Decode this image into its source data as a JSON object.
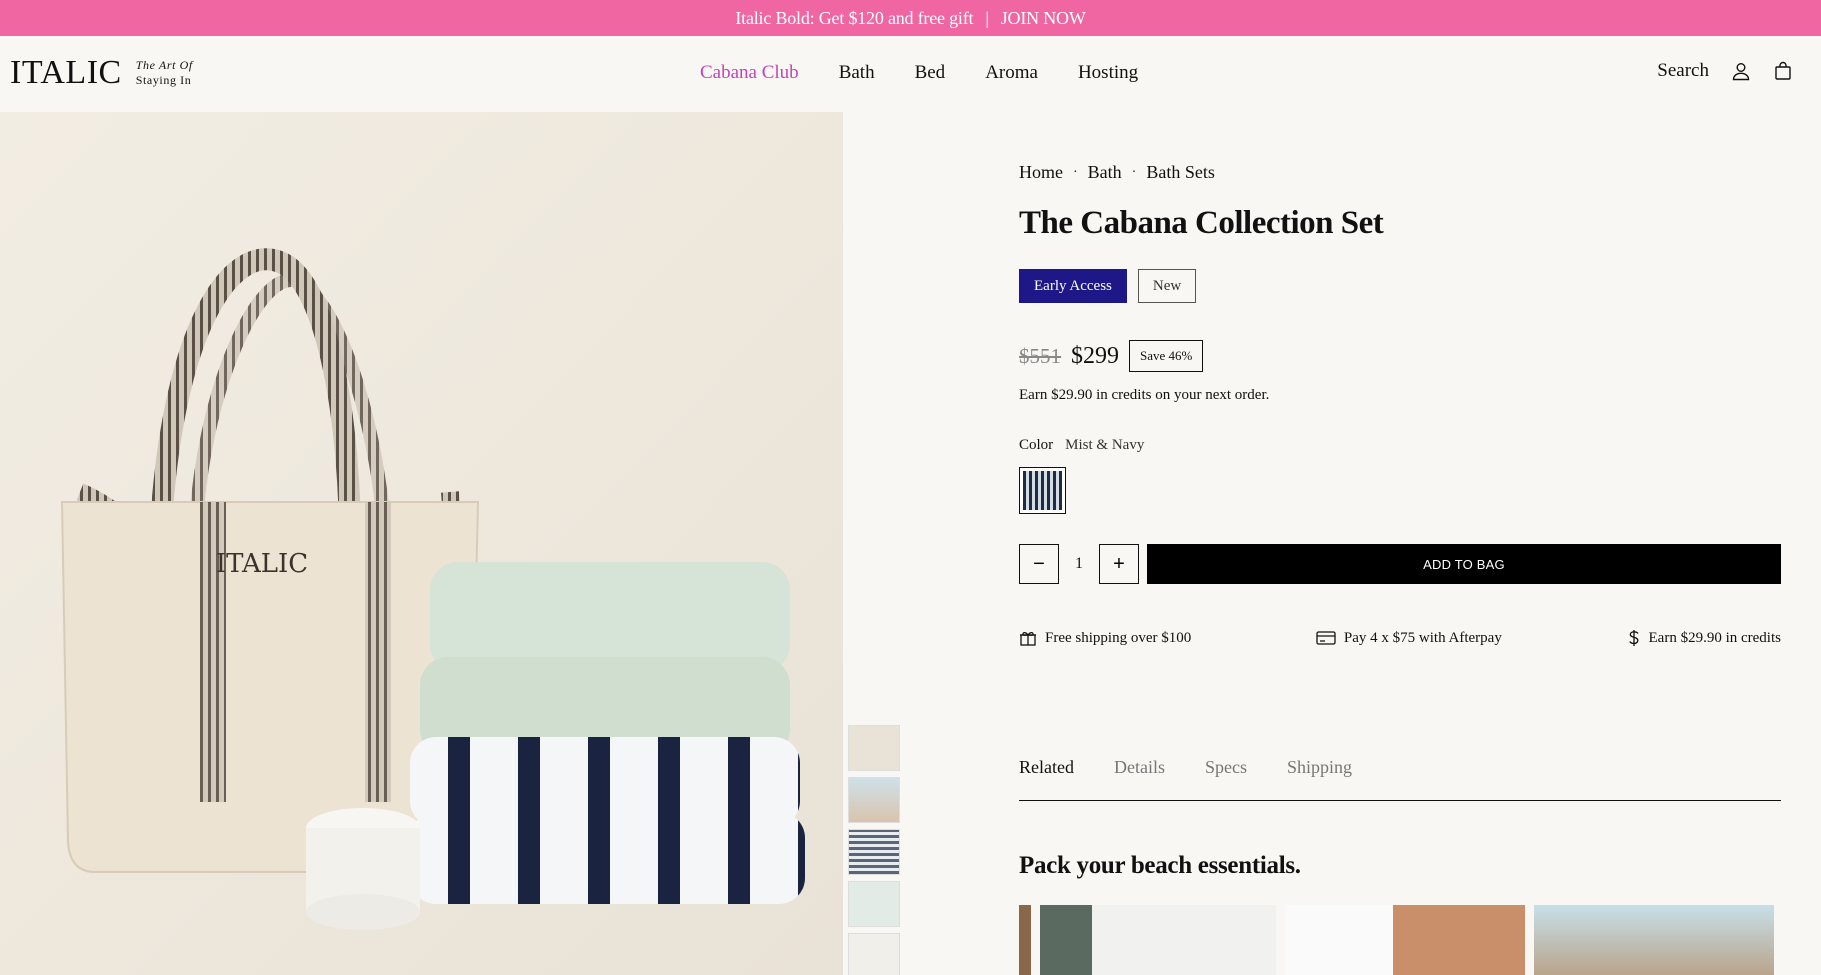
{
  "promo": {
    "text": "Italic Bold: Get $120 and free gift",
    "separator": "|",
    "cta": "JOIN NOW"
  },
  "header": {
    "logo": "ITALIC",
    "tagline_1": "The Art Of",
    "tagline_2": "Staying In",
    "menu": [
      "Cabana Club",
      "Bath",
      "Bed",
      "Aroma",
      "Hosting"
    ],
    "search": "Search",
    "accent_color": "#c244b3"
  },
  "product": {
    "breadcrumbs": [
      "Home",
      "Bath",
      "Bath Sets"
    ],
    "breadcrumb_sep": "·",
    "title": "The Cabana Collection Set",
    "badges": {
      "early": "Early Access",
      "new": "New"
    },
    "old_price": "$551",
    "price": "$299",
    "save": "Save 46%",
    "credits": "Earn $29.90 in credits on your next order.",
    "color_label": "Color",
    "color_value": "Mist & Navy",
    "quantity": "1",
    "add_to_bag": "ADD TO BAG",
    "perks": [
      "Free shipping over $100",
      "Pay 4 x $75 with Afterpay",
      "Earn $29.90 in credits"
    ],
    "tabs": [
      "Related",
      "Details",
      "Specs",
      "Shipping"
    ],
    "section_title": "Pack your beach essentials.",
    "badge_color": "#1d1787",
    "promo_color": "#ef66a3"
  }
}
